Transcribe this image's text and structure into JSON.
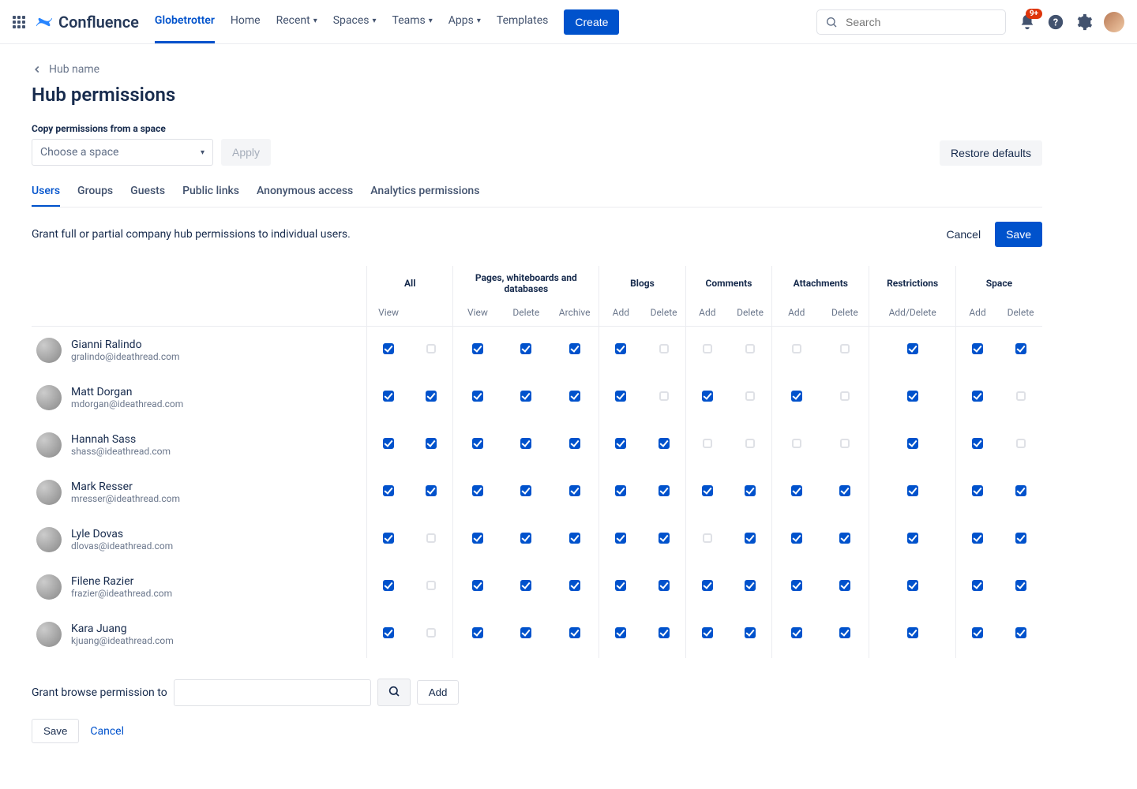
{
  "brand": "Confluence",
  "nav": {
    "items": [
      "Globetrotter",
      "Home",
      "Recent",
      "Spaces",
      "Teams",
      "Apps",
      "Templates"
    ],
    "dropdown_indices": [
      2,
      3,
      4,
      5
    ],
    "active_index": 0,
    "create": "Create"
  },
  "search": {
    "placeholder": "Search"
  },
  "notifications": {
    "badge": "9+"
  },
  "breadcrumb": {
    "label": "Hub name"
  },
  "page": {
    "title": "Hub permissions",
    "copy_label": "Copy permissions from a space",
    "choose_space": "Choose a space",
    "apply": "Apply",
    "restore": "Restore defaults"
  },
  "tabs": [
    "Users",
    "Groups",
    "Guests",
    "Public links",
    "Anonymous access",
    "Analytics permissions"
  ],
  "tabs_active": 0,
  "description": "Grant full or partial company hub permissions to individual users.",
  "actions": {
    "cancel": "Cancel",
    "save": "Save"
  },
  "columns": {
    "groups": [
      "All",
      "Pages, whiteboards and databases",
      "Blogs",
      "Comments",
      "Attachments",
      "Restrictions",
      "Space"
    ],
    "sub": {
      "all": [
        "View",
        ""
      ],
      "pages": [
        "View",
        "Delete",
        "Archive"
      ],
      "blogs": [
        "Add",
        "Delete"
      ],
      "comments": [
        "Add",
        "Delete"
      ],
      "attachments": [
        "Add",
        "Delete"
      ],
      "restrictions": [
        "Add/Delete"
      ],
      "space": [
        "Add",
        "Delete"
      ]
    }
  },
  "users": [
    {
      "name": "Gianni Ralindo",
      "email": "gralindo@ideathread.com",
      "perms": [
        1,
        0,
        1,
        1,
        1,
        1,
        0,
        0,
        0,
        0,
        0,
        1,
        1,
        1
      ]
    },
    {
      "name": "Matt Dorgan",
      "email": "mdorgan@ideathread.com",
      "perms": [
        1,
        1,
        1,
        1,
        1,
        1,
        0,
        1,
        0,
        1,
        0,
        1,
        1,
        0
      ]
    },
    {
      "name": "Hannah Sass",
      "email": "shass@ideathread.com",
      "perms": [
        1,
        1,
        1,
        1,
        1,
        1,
        1,
        0,
        0,
        0,
        0,
        1,
        1,
        0
      ]
    },
    {
      "name": "Mark Resser",
      "email": "mresser@ideathread.com",
      "perms": [
        1,
        1,
        1,
        1,
        1,
        1,
        1,
        1,
        1,
        1,
        1,
        1,
        1,
        1
      ]
    },
    {
      "name": "Lyle Dovas",
      "email": "dlovas@ideathread.com",
      "perms": [
        1,
        0,
        1,
        1,
        1,
        1,
        1,
        0,
        1,
        1,
        1,
        1,
        1,
        1
      ]
    },
    {
      "name": "Filene Razier",
      "email": "frazier@ideathread.com",
      "perms": [
        1,
        0,
        1,
        1,
        1,
        1,
        1,
        1,
        1,
        1,
        1,
        1,
        1,
        1
      ]
    },
    {
      "name": "Kara Juang",
      "email": "kjuang@ideathread.com",
      "perms": [
        1,
        0,
        1,
        1,
        1,
        1,
        1,
        1,
        1,
        1,
        1,
        1,
        1,
        1
      ]
    }
  ],
  "grant": {
    "label": "Grant browse permission to",
    "add": "Add"
  },
  "bottom": {
    "save": "Save",
    "cancel": "Cancel"
  }
}
